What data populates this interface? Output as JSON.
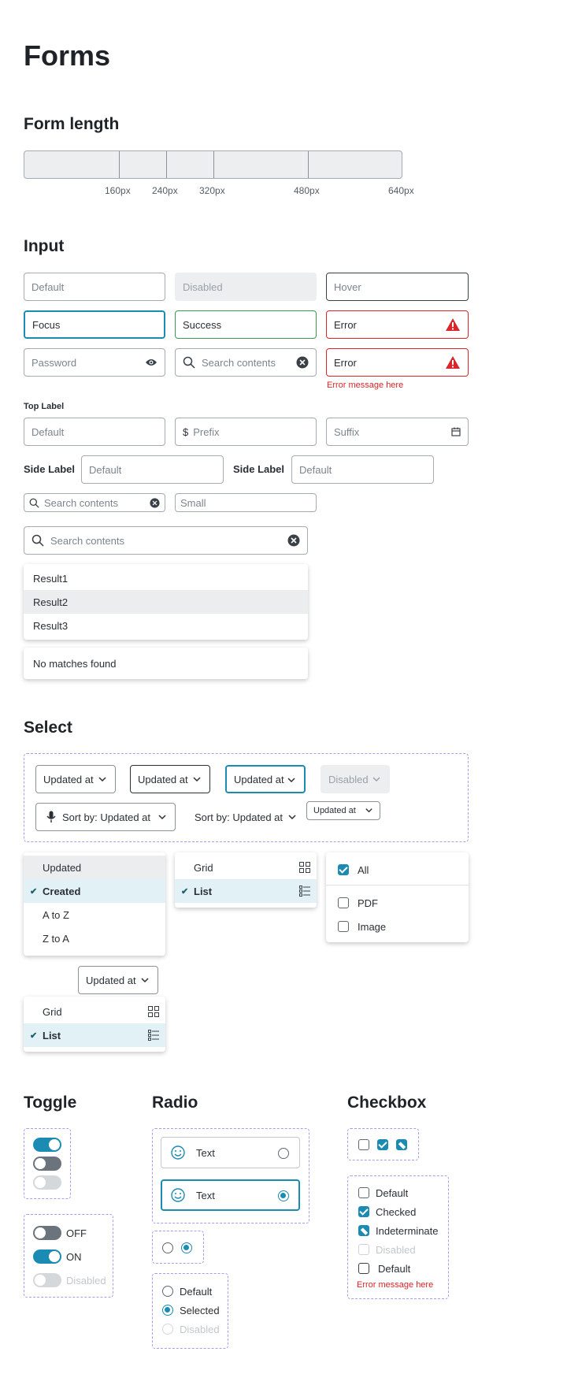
{
  "page_title": "Forms",
  "form_length": {
    "heading": "Form length",
    "ticks": [
      "160px",
      "240px",
      "320px",
      "480px",
      "640px"
    ]
  },
  "input": {
    "heading": "Input",
    "default": "Default",
    "disabled": "Disabled",
    "hover": "Hover",
    "focus": "Focus",
    "success": "Success",
    "error": "Error",
    "password": "Password",
    "search": "Search contents",
    "error2": "Error",
    "error_message": "Error message here",
    "top_label": "Top Label",
    "top_default": "Default",
    "prefix_symbol": "$",
    "prefix": "Prefix",
    "suffix": "Suffix",
    "side_label_1": "Side Label",
    "side_default_1": "Default",
    "side_label_2": "Side Label",
    "side_default_2": "Default",
    "small_search": "Search contents",
    "small": "Small",
    "large_search": "Search contents",
    "results": [
      "Result1",
      "Result2",
      "Result3"
    ],
    "no_matches": "No matches found"
  },
  "select": {
    "heading": "Select",
    "btn1": "Updated at",
    "btn2": "Updated at",
    "btn3": "Updated at",
    "btn_disabled": "Disabled",
    "sort_mic": "Sort by: Updated at",
    "sort_plain": "Sort by: Updated at",
    "small_btn": "Updated at",
    "sort_menu": [
      "Updated",
      "Created",
      "A to Z",
      "Z to A"
    ],
    "view_menu": [
      "Grid",
      "List"
    ],
    "filter_menu": [
      "All",
      "PDF",
      "Image"
    ],
    "lone_btn": "Updated at",
    "view_menu2": [
      "Grid",
      "List"
    ]
  },
  "toggle": {
    "heading": "Toggle",
    "off": "OFF",
    "on": "ON",
    "disabled": "Disabled"
  },
  "radio": {
    "heading": "Radio",
    "card1": "Text",
    "card2": "Text",
    "default": "Default",
    "selected": "Selected",
    "disabled": "Disabled"
  },
  "checkbox": {
    "heading": "Checkbox",
    "default": "Default",
    "checked": "Checked",
    "indeterminate": "Indeterminate",
    "disabled": "Disabled",
    "default2": "Default",
    "error_message": "Error message here"
  },
  "colors": {
    "accent": "#1b8bb3",
    "error": "#d8262a",
    "success": "#3d9a53",
    "dashed": "#a99cf0"
  }
}
